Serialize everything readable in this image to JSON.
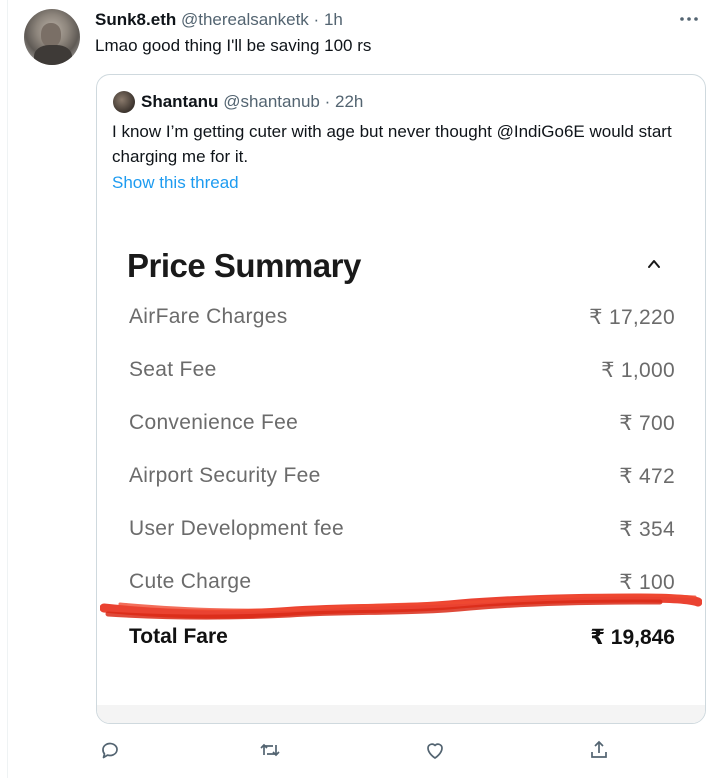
{
  "tweet": {
    "author_name": "Sunk8.eth",
    "handle": "@therealsanketk",
    "separator": "·",
    "time": "1h",
    "text": "Lmao good thing I'll be saving 100 rs",
    "more_icon": "more-dots-icon"
  },
  "quoted": {
    "author_name": "Shantanu",
    "handle": "@shantanub",
    "separator": "·",
    "time": "22h",
    "text": "I know I’m getting cuter with age but never thought @IndiGo6E would start charging me for it.",
    "show_thread": "Show this thread"
  },
  "receipt": {
    "title": "Price Summary",
    "chevron_icon": "chevron-up-icon",
    "rows": [
      {
        "label": "AirFare Charges",
        "value": "₹ 17,220"
      },
      {
        "label": "Seat Fee",
        "value": "₹ 1,000"
      },
      {
        "label": "Convenience Fee",
        "value": "₹ 700"
      },
      {
        "label": "Airport Security Fee",
        "value": "₹ 472"
      },
      {
        "label": "User Development fee",
        "value": "₹ 354"
      },
      {
        "label": "Cute Charge",
        "value": "₹ 100"
      }
    ],
    "total_label": "Total Fare",
    "total_value": "₹ 19,846",
    "scribble_color": "#e8321f"
  },
  "actions": {
    "icons": [
      "reply-icon",
      "retweet-icon",
      "like-icon",
      "share-icon"
    ]
  },
  "colors": {
    "link": "#1d9bf0",
    "muted": "#536471",
    "text": "#0f1419"
  }
}
